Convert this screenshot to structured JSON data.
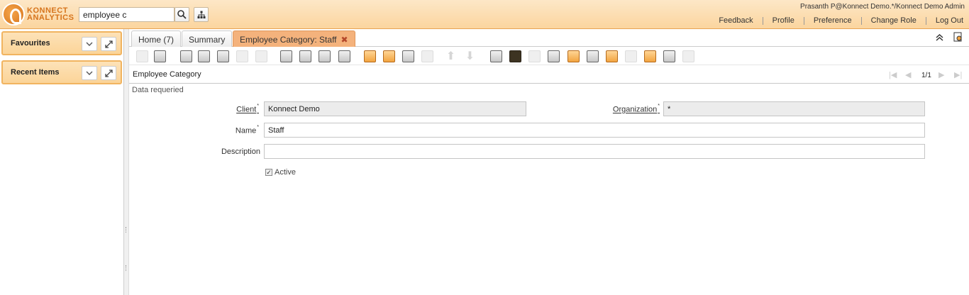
{
  "header": {
    "logo_line1": "KONNECT",
    "logo_line2": "ANALYTICS",
    "search_value": "employee c",
    "user_info": "Prasanth P@Konnect Demo.*/Konnect Demo Admin",
    "links": [
      "Feedback",
      "Profile",
      "Preference",
      "Change Role",
      "Log Out"
    ]
  },
  "sidebar": {
    "panels": [
      {
        "label": "Favourites"
      },
      {
        "label": "Recent Items"
      }
    ]
  },
  "tabs": [
    {
      "label": "Home (7)"
    },
    {
      "label": "Summary"
    },
    {
      "label": "Employee Category: Staff",
      "close": "✖"
    }
  ],
  "window": {
    "title": "Employee Category",
    "page": "1/1",
    "status": "Data requeried"
  },
  "form": {
    "client_label": "Client",
    "client_value": "Konnect Demo",
    "org_label": "Organization",
    "org_value": "*",
    "name_label": "Name",
    "name_value": "Staff",
    "description_label": "Description",
    "description_value": "",
    "active_label": "Active",
    "active_checked": true,
    "required_mark": "*"
  },
  "colors": {
    "header_bg": "#fbd59f",
    "accent": "#f4b27c",
    "panel_border": "#f1b460"
  }
}
